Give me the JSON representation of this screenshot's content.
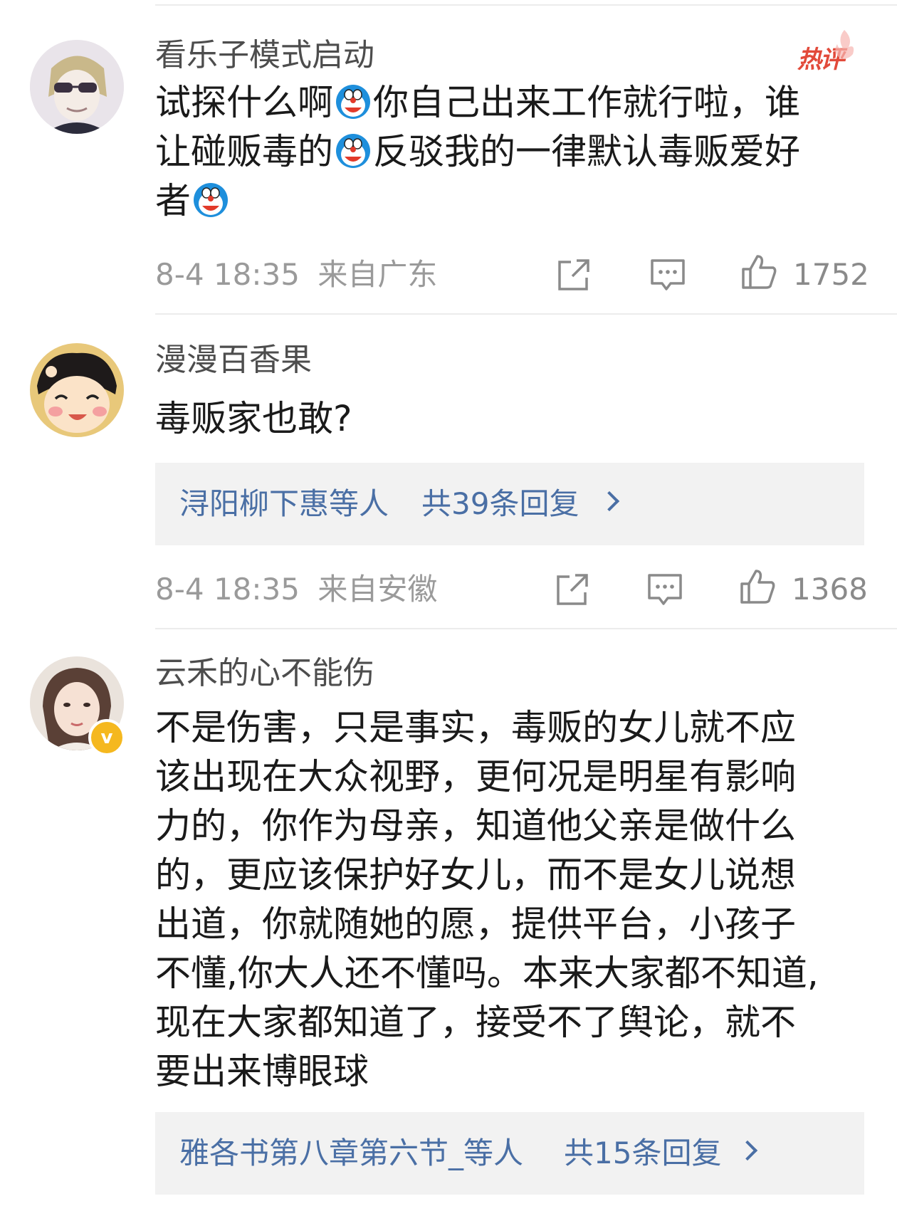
{
  "comments": [
    {
      "username": "看乐子模式启动",
      "badge": "热评",
      "lines": [
        [
          "试探什么啊",
          "[emoji]",
          "你自己出来工作就行啦，谁"
        ],
        [
          "让碰贩毒的",
          "[emoji]",
          "反驳我的一律默认毒贩爱好"
        ],
        [
          "者",
          "[emoji]",
          ""
        ]
      ],
      "time": "8-4 18:35",
      "location": "来自广东",
      "likes": "1752"
    },
    {
      "username": "漫漫百香果",
      "lines": [
        "毒贩家也敢?"
      ],
      "reply_users": "浔阳柳下惠等人",
      "reply_count": "共39条回复",
      "time": "8-4 18:35",
      "location": "来自安徽",
      "likes": "1368"
    },
    {
      "username": "云禾的心不能伤",
      "verified_badge": "v",
      "lines": [
        "不是伤害，只是事实，毒贩的女儿就不应",
        "该出现在大众视野，更何况是明星有影响",
        "力的，你作为母亲，知道他父亲是做什么",
        "的，更应该保护好女儿，而不是女儿说想",
        "出道，你就随她的愿，提供平台，小孩子",
        "不懂,你大人还不懂吗。本来大家都不知道,",
        "现在大家都知道了，接受不了舆论，就不",
        "要出来博眼球"
      ],
      "reply_users": "雅各书第八章第六节_等人",
      "reply_count": "共15条回复"
    }
  ],
  "colors": {
    "link_blue": "#4a6fa5",
    "hot_red": "#e24a3a",
    "meta_gray": "#9a9a9a"
  },
  "icons": [
    "share-icon",
    "comment-icon",
    "like-icon",
    "chevron-right-icon",
    "doraemon-emoji"
  ]
}
